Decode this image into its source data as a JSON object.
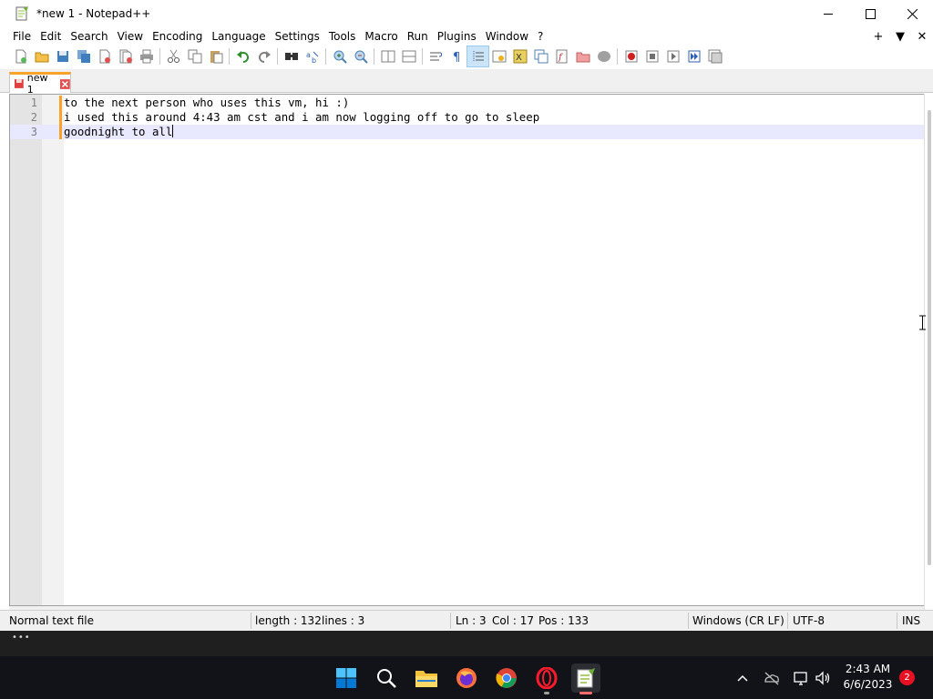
{
  "window": {
    "title": "*new 1 - Notepad++"
  },
  "menu": {
    "items": [
      "File",
      "Edit",
      "Search",
      "View",
      "Encoding",
      "Language",
      "Settings",
      "Tools",
      "Macro",
      "Run",
      "Plugins",
      "Window",
      "?"
    ],
    "right_plus": "+",
    "right_dropdown": "▼",
    "right_close": "✕"
  },
  "toolbar": {
    "icons": [
      "new-file-icon",
      "open-file-icon",
      "save-icon",
      "save-all-icon",
      "close-icon",
      "close-all-icon",
      "print-icon",
      "cut-icon",
      "copy-icon",
      "paste-icon",
      "undo-icon",
      "redo-icon",
      "find-icon",
      "replace-icon",
      "zoom-in-icon",
      "zoom-out-icon",
      "sync-vertical-icon",
      "sync-horizontal-icon",
      "word-wrap-icon",
      "show-all-characters-icon",
      "indent-guide-icon",
      "user-defined-language-icon",
      "document-map-icon",
      "document-list-icon",
      "function-list-icon",
      "folder-as-workspace-icon",
      "monitoring-icon",
      "record-macro-icon",
      "stop-recording-icon",
      "playback-macro-icon",
      "run-macro-multiple-icon",
      "save-macro-icon"
    ],
    "active_icon": "indent-guide-icon"
  },
  "tab": {
    "label": "new 1",
    "modified": true
  },
  "editor": {
    "lines": [
      {
        "number": "1",
        "text": "to the next person who uses this vm, hi :)"
      },
      {
        "number": "2",
        "text": "i used this around 4:43 am cst and i am now logging off to go to sleep"
      },
      {
        "number": "3",
        "text": "goodnight to all"
      }
    ],
    "current_line": 3
  },
  "status": {
    "file_type": "Normal text file",
    "length": "length : 132",
    "lines": "lines : 3",
    "ln": "Ln : 3",
    "col": "Col : 17",
    "pos": "Pos : 133",
    "eol": "Windows (CR LF)",
    "encoding": "UTF-8",
    "mode": "INS"
  },
  "taskbar": {
    "apps": [
      "windows-start-icon",
      "search-icon",
      "file-explorer-icon",
      "firefox-icon",
      "chrome-icon",
      "opera-icon",
      "notepad-plus-plus-icon"
    ],
    "time": "2:43 AM",
    "date": "6/6/2023",
    "notification_count": "2"
  },
  "colors": {
    "tab_accent": "#f8a22a",
    "current_line_bg": "#e8e8ff",
    "taskbar_bg": "#111318",
    "notification_badge": "#e81123"
  }
}
